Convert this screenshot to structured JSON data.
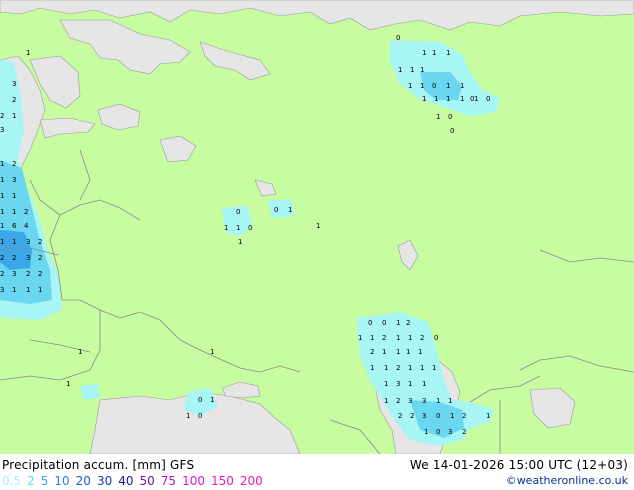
{
  "map": {
    "colors": {
      "land_no_precip": "#c8fca0",
      "sea": "#e6e6e6",
      "precip_light": "#a8f5f5",
      "precip_medium": "#6ad6f0",
      "precip_heavy": "#3aa8e8",
      "borders": "#8a8a8a"
    },
    "value_labels": [
      "1",
      "1",
      "1",
      "1",
      "0",
      "1",
      "1",
      "1",
      "1",
      "1",
      "0",
      "1",
      "1",
      "0",
      "1",
      "1",
      "1",
      "1",
      "1",
      "0",
      "1",
      "0",
      "0",
      "0",
      "0",
      "1",
      "1",
      "1",
      "0",
      "1",
      "1",
      "0",
      "0",
      "1",
      "2",
      "1",
      "1",
      "2",
      "1",
      "1",
      "2",
      "0",
      "2",
      "1",
      "1",
      "1",
      "1",
      "1",
      "1",
      "2",
      "1",
      "1",
      "1",
      "1",
      "3",
      "1",
      "1",
      "1",
      "2",
      "3",
      "3",
      "1",
      "1",
      "2",
      "2",
      "3",
      "0",
      "1",
      "2",
      "1",
      "1",
      "0",
      "3",
      "2",
      "0",
      "1",
      "1",
      "0",
      "1",
      "1",
      "1",
      "3",
      "2",
      "2",
      "1",
      "3",
      "1",
      "2",
      "1",
      "3",
      "1",
      "1",
      "1",
      "1",
      "2",
      "1",
      "6",
      "4",
      "1",
      "1",
      "3",
      "2",
      "2",
      "2",
      "3",
      "2",
      "2",
      "3",
      "2",
      "2",
      "3",
      "1",
      "1",
      "1"
    ]
  },
  "footer": {
    "title": "Precipitation accum. [mm] GFS",
    "datetime": "We 14-01-2026 15:00 UTC (12+03)",
    "credit": "©weatheronline.co.uk",
    "legend": [
      {
        "label": "0.5",
        "color": "#a8f5f5"
      },
      {
        "label": "2",
        "color": "#6ad6f0"
      },
      {
        "label": "5",
        "color": "#3aa8e8"
      },
      {
        "label": "10",
        "color": "#2c7ee0"
      },
      {
        "label": "20",
        "color": "#1e5ad8"
      },
      {
        "label": "30",
        "color": "#1a3cb8"
      },
      {
        "label": "40",
        "color": "#1a1a98"
      },
      {
        "label": "50",
        "color": "#6a1aa0"
      },
      {
        "label": "75",
        "color": "#b01ab8"
      },
      {
        "label": "100",
        "color": "#d41ad0"
      },
      {
        "label": "150",
        "color": "#e41ab4"
      },
      {
        "label": "200",
        "color": "#f01aa8"
      }
    ]
  }
}
